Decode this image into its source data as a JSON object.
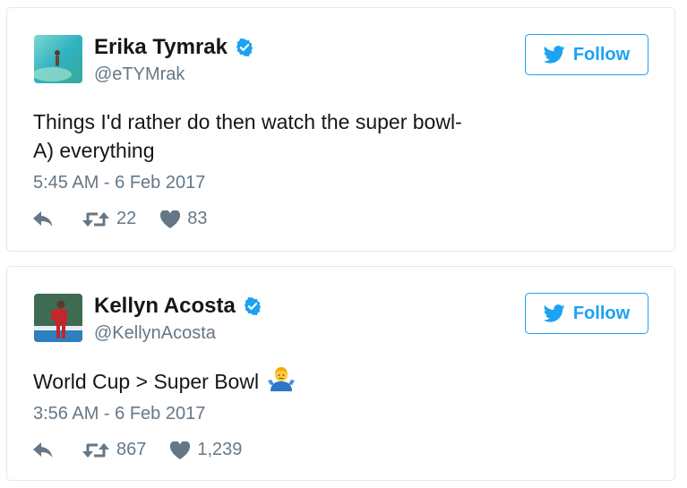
{
  "tweets": [
    {
      "author": {
        "name": "Erika Tymrak",
        "handle": "@eTYMrak",
        "verified": true
      },
      "follow_label": "Follow",
      "text_lines": [
        "Things I'd rather do then watch the super bowl-",
        "A) everything"
      ],
      "timestamp": "5:45 AM - 6 Feb 2017",
      "retweets": "22",
      "likes": "83"
    },
    {
      "author": {
        "name": "Kellyn Acosta",
        "handle": "@KellynAcosta",
        "verified": true
      },
      "follow_label": "Follow",
      "text_lines": [
        "World Cup > Super Bowl"
      ],
      "emoji": "man-shrugging",
      "timestamp": "3:56 AM - 6 Feb 2017",
      "retweets": "867",
      "likes": "1,239"
    }
  ],
  "colors": {
    "accent": "#1da1f2",
    "muted": "#657786",
    "border": "#e1e8ed",
    "text": "#14171a"
  },
  "icons": {
    "reply": "reply-icon",
    "retweet": "retweet-icon",
    "like": "heart-icon",
    "verified": "verified-badge-icon",
    "bird": "twitter-bird-icon"
  }
}
